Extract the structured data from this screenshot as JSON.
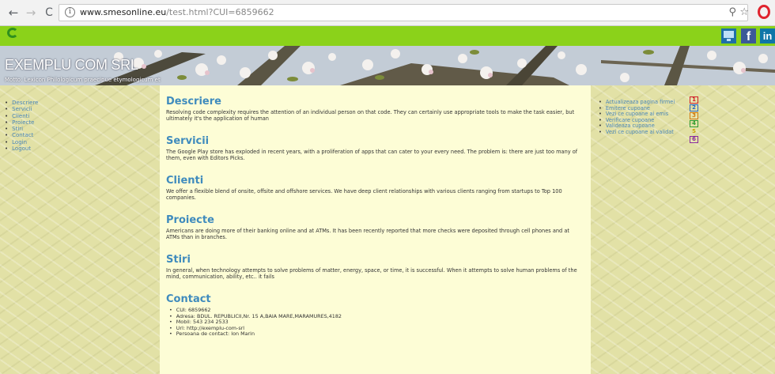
{
  "browser": {
    "url_host": "www.smesonline.eu",
    "url_path": "/test.html?CUI=6859662",
    "back_icon": "arrow-left-icon",
    "forward_icon": "arrow-right-icon",
    "reload_icon": "reload-icon"
  },
  "banner": {
    "title": "EXEMPLU COM SRL",
    "subtitle": "Motto: Lexicon Philologicum praecipue etymologicum et"
  },
  "left_nav": [
    "Descriere",
    "Servicii",
    "Clienti",
    "Proiecte",
    "Stiri",
    "Contact",
    "Login",
    "Logout"
  ],
  "sections": [
    {
      "title": "Descriere",
      "text": "Resolving code complexity requires the attention of an individual person on that code. They can certainly use appropriate tools to make the task easier, but ultimately it's the application of human"
    },
    {
      "title": "Servicii",
      "text": "The Google Play store has exploded in recent years, with a proliferation of apps that can cater to your every need. The problem is: there are just too many of them, even with Editors Picks."
    },
    {
      "title": "Clienti",
      "text": "We offer a flexible blend of onsite, offsite and offshore services. We have deep client relationships with various clients ranging from startups to Top 100 companies."
    },
    {
      "title": "Proiecte",
      "text": "Americans are doing more of their banking online and at ATMs. It has been recently reported that more checks were deposited through cell phones and at ATMs than in branches."
    },
    {
      "title": "Stiri",
      "text": "In general, when technology attempts to solve problems of matter, energy, space, or time, it is successful. When it attempts to solve human problems of the mind, communication, ability, etc.. it fails"
    }
  ],
  "contact": {
    "title": "Contact",
    "items": [
      "CUI: 6859662",
      "Adresa: BDUL. REPUBLICII,Nr. 15 A,BAIA MARE,MARAMURES,4182",
      "Mobil: 543 234 2533",
      "Url: http://exemplu-com-srl",
      "Persoana de contact: Ion Marin"
    ]
  },
  "right_nav": [
    "Actualizeaza pagina firmei",
    "Emitere cupoane",
    "Vezi ce cupoane ai emis",
    "Verificare cupoane",
    "Valideaza cupoane",
    "Vezi ce cupoane ai validat"
  ],
  "badges": [
    {
      "label": "1",
      "color": "#d0202a"
    },
    {
      "label": "2",
      "color": "#2a66c4"
    },
    {
      "label": "3",
      "color": "#d07a12"
    },
    {
      "label": "4",
      "color": "#2e9a2e"
    },
    {
      "label": "5",
      "color": "#c8a400"
    },
    {
      "label": "6",
      "color": "#8a2a9e"
    }
  ],
  "colors": {
    "green_bar": "#8bd21a",
    "content_bg": "#fdfdd6",
    "heading": "#3f8bbd",
    "link": "#4a86b8"
  }
}
